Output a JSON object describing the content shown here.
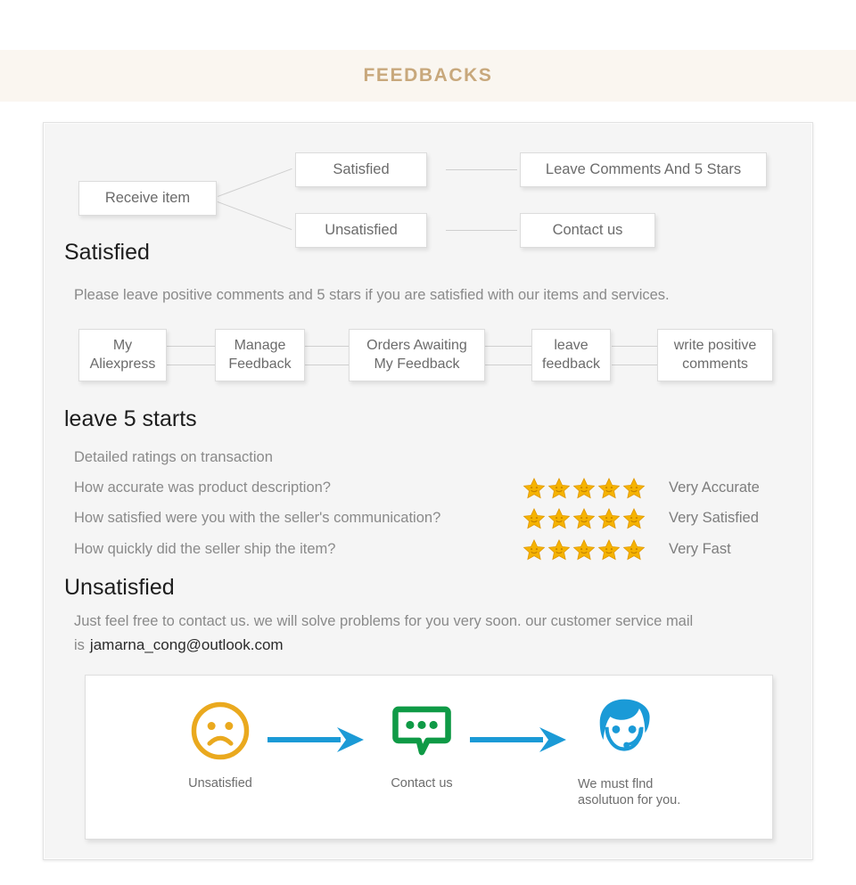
{
  "header": {
    "title": "FEEDBACKS",
    "accent_color": "#c8a87c",
    "band_color": "#faf6f0"
  },
  "flow_top": {
    "start": {
      "label": "Receive item"
    },
    "branches": [
      {
        "label": "Satisfied",
        "result": "Leave Comments And 5 Stars"
      },
      {
        "label": "Unsatisfied",
        "result": "Contact us"
      }
    ]
  },
  "satisfied": {
    "heading": "Satisfied",
    "description": "Please leave positive comments and 5 stars if you are satisfied with our items and services.",
    "steps": [
      {
        "line1": "My",
        "line2": "Aliexpress"
      },
      {
        "line1": "Manage",
        "line2": "Feedback"
      },
      {
        "line1": "Orders Awaiting",
        "line2": "My Feedback"
      },
      {
        "line1": "leave",
        "line2": "feedback"
      },
      {
        "line1": "write positive",
        "line2": "comments"
      }
    ]
  },
  "ratings": {
    "heading": "leave 5 starts",
    "subtitle": "Detailed ratings on transaction",
    "star_color": "#f5b301",
    "rows": [
      {
        "question": "How accurate was product description?",
        "stars": 5,
        "value": "Very Accurate"
      },
      {
        "question": "How satisfied were you with the seller's communication?",
        "stars": 5,
        "value": "Very Satisfied"
      },
      {
        "question": "How quickly did the seller ship the item?",
        "stars": 5,
        "value": "Very Fast"
      }
    ]
  },
  "unsatisfied": {
    "heading": "Unsatisfied",
    "description": "Just feel free to contact us. we will solve problems for you very soon. our customer service mail is",
    "email": "jamarna_cong@outlook.com"
  },
  "illustration": {
    "items": [
      {
        "icon": "sad-face-icon",
        "caption": "Unsatisfied",
        "color": "#eaa91e"
      },
      {
        "icon": "chat-bubble-icon",
        "caption": "Contact us",
        "color": "#0f9a46"
      },
      {
        "icon": "support-agent-icon",
        "caption": "We must flnd asolutuon for you.",
        "color": "#1a9ad7"
      }
    ],
    "arrow_color": "#1b9ad6"
  }
}
